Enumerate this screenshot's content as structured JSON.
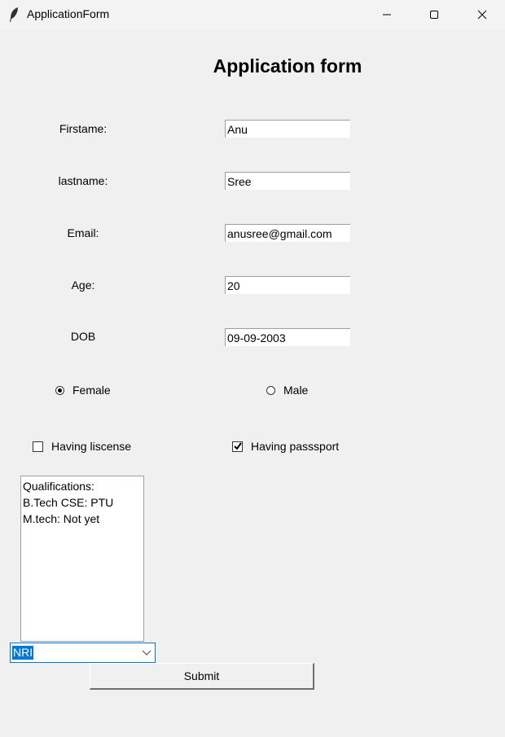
{
  "window": {
    "title": "ApplicationForm",
    "icon": "feather-icon",
    "controls": [
      "minimize-icon",
      "maximize-icon",
      "close-icon"
    ]
  },
  "form": {
    "title": "Application form",
    "fields": {
      "firstname": {
        "label": "Firstame:",
        "value": "Anu"
      },
      "lastname": {
        "label": "lastname:",
        "value": "Sree"
      },
      "email": {
        "label": "Email:",
        "value": "anusree@gmail.com"
      },
      "age": {
        "label": "Age:",
        "value": "20"
      },
      "dob": {
        "label": "DOB",
        "value": "09-09-2003"
      }
    },
    "gender": {
      "female": {
        "label": "Female",
        "selected": true
      },
      "male": {
        "label": "Male",
        "selected": false
      }
    },
    "checks": {
      "license": {
        "label": "Having liscense",
        "checked": false
      },
      "passport": {
        "label": "Having passsport",
        "checked": true
      }
    },
    "qualifications_text": "Qualifications:\nB.Tech CSE: PTU\nM.tech: Not yet",
    "category_select": {
      "value": "NRI",
      "icon": "chevron-down-icon"
    },
    "submit_label": "Submit"
  },
  "colors": {
    "background": "#f0f0f0",
    "selection": "#0078d7"
  }
}
